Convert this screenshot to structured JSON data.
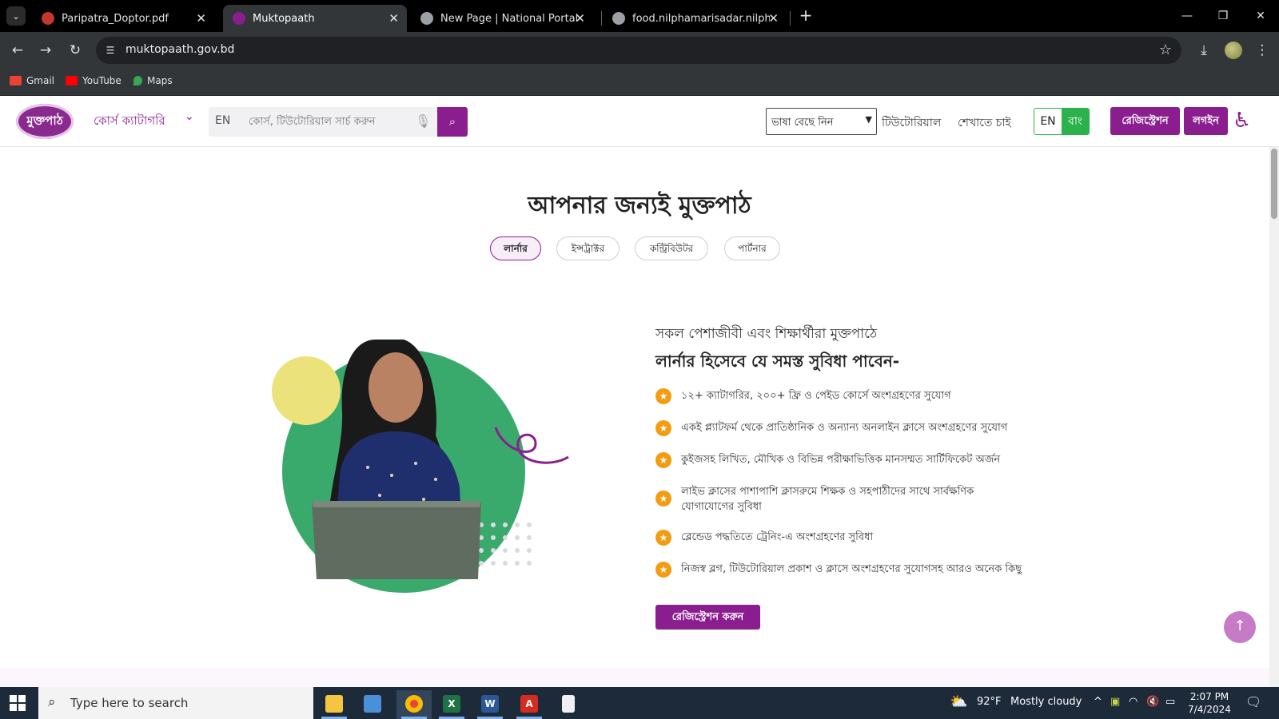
{
  "browser": {
    "tabs": [
      {
        "title": "Paripatra_Doptor.pdf",
        "favicon_color": "#c0392b",
        "active": false
      },
      {
        "title": "Muktopaath",
        "favicon_color": "#8b1e8f",
        "active": true
      },
      {
        "title": "New Page | National Portal",
        "favicon_color": "#9aa0a6",
        "active": false
      },
      {
        "title": "food.nilphamarisadar.nilphamari",
        "favicon_color": "#9aa0a6",
        "active": false
      }
    ],
    "new_tab_symbol": "+",
    "url": "muktopaath.gov.bd",
    "bookmarks": [
      {
        "label": "Gmail",
        "icon": "gmail-icon",
        "color": "#ea4335"
      },
      {
        "label": "YouTube",
        "icon": "youtube-icon",
        "color": "#ff0000"
      },
      {
        "label": "Maps",
        "icon": "maps-icon",
        "color": "#34a853"
      }
    ]
  },
  "site": {
    "logo_text": "মুক্তপাঠ",
    "category_label": "কোর্স ক্যাটাগরি",
    "search": {
      "lang": "EN",
      "placeholder": "কোর্স, টিউটোরিয়াল সার্চ করুন"
    },
    "language_select": "ভাষা বেছে নিন",
    "nav_tutorial": "টিউটোরিয়াল",
    "nav_teach": "শেখাতে চাই",
    "lang_en": "EN",
    "lang_bn": "বাং",
    "register_label": "রেজিস্ট্রেশন",
    "login_label": "লগইন",
    "accent_color": "#8b1e8f"
  },
  "main": {
    "title": "আপনার জন্যই মুক্তপাঠ",
    "tabs": [
      "লার্নার",
      "ইন্সট্রাক্টর",
      "কন্ট্রিবিউটর",
      "পার্টনার"
    ],
    "active_tab": 0,
    "subtitle": "সকল পেশাজীবী এবং শিক্ষার্থীরা মুক্তপাঠে",
    "heading": "লার্নার হিসেবে যে সমস্ত সুবিধা পাবেন-",
    "features": [
      "১২+ ক্যাটাগরির, ২০০+ ফ্রি ও পেইড কোর্সে অংশগ্রহণের সুযোগ",
      "একই প্ল্যাটফর্ম থেকে প্রাতিষ্ঠানিক ও অন্যান্য অনলাইন ক্লাসে অংশগ্রহণের সুযোগ",
      "কুইজসহ লিখিত, মৌখিক ও বিভিন্ন পরীক্ষাভিত্তিক মানসম্মত সার্টিফিকেট অর্জন",
      "লাইভ ক্লাসের পাশাপাশি ক্লাসরুমে শিক্ষক ও সহপাঠীদের সাথে সার্বক্ষণিক যোগাযোগের সুবিধা",
      "ব্লেন্ডেড পদ্ধতিতে ট্রেনিং-এ অংশগ্রহণের সুবিধা",
      "নিজস্ব ব্লগ, টিউটোরিয়াল প্রকাশ ও ক্লাসে অংশগ্রহণের সুযোগসহ আরও অনেক কিছু"
    ],
    "cta_label": "রেজিস্ট্রেশন করুন"
  },
  "taskbar": {
    "search_placeholder": "Type here to search",
    "weather_temp": "92°F",
    "weather_text": "Mostly cloudy",
    "time": "2:07 PM",
    "date": "7/4/2024"
  }
}
